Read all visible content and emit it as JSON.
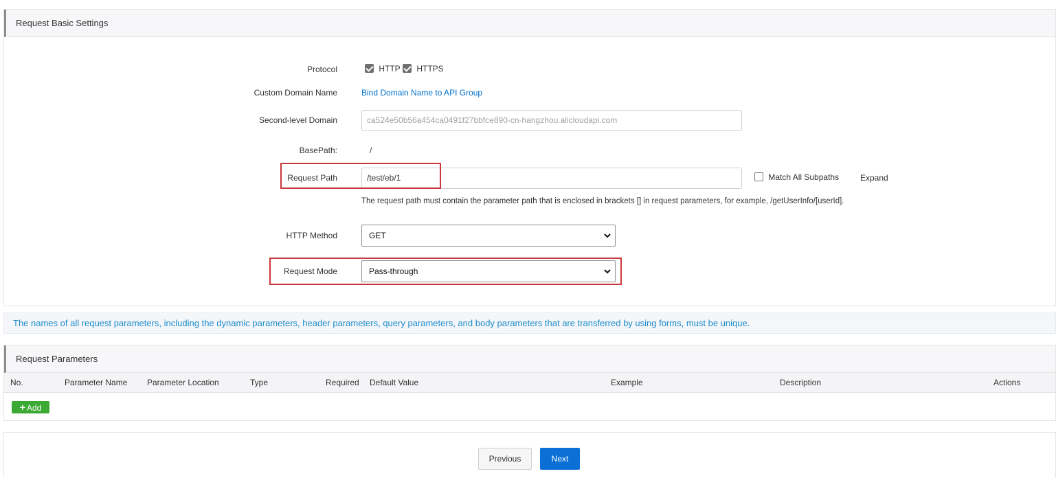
{
  "basic": {
    "title": "Request Basic Settings",
    "protocol": {
      "label": "Protocol",
      "http": "HTTP",
      "https": "HTTPS"
    },
    "custom_domain": {
      "label": "Custom Domain Name",
      "link": "Bind Domain Name to API Group"
    },
    "second_level": {
      "label": "Second-level Domain",
      "value": "ca524e50b56a454ca0491f27bbfce890-cn-hangzhou.alicloudapi.com"
    },
    "basepath": {
      "label": "BasePath:",
      "value": "/"
    },
    "request_path": {
      "label": "Request Path",
      "value": "/test/eb/1",
      "match_all": "Match All Subpaths",
      "expand": "Expand",
      "hint": "The request path must contain the parameter path that is enclosed in brackets [] in request parameters, for example, /getUserInfo/[userId]."
    },
    "http_method": {
      "label": "HTTP Method",
      "value": "GET"
    },
    "request_mode": {
      "label": "Request Mode",
      "value": "Pass-through"
    }
  },
  "notice": "The names of all request parameters, including the dynamic parameters, header parameters, query parameters, and body parameters that are transferred by using forms, must be unique.",
  "params": {
    "title": "Request Parameters",
    "columns": [
      "No.",
      "Parameter Name",
      "Parameter Location",
      "Type",
      "Required",
      "Default Value",
      "Example",
      "Description",
      "Actions"
    ],
    "add_label": "Add"
  },
  "footer": {
    "previous": "Previous",
    "next": "Next"
  },
  "colors": {
    "accent": "#0a6fd6",
    "add": "#3da935",
    "highlight": "#c9363b",
    "notice": "#1a8ccc"
  }
}
